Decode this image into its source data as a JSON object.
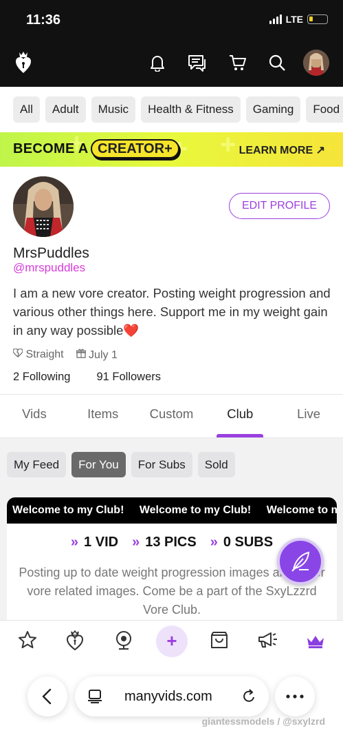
{
  "status": {
    "time": "11:36",
    "network": "LTE"
  },
  "categories": [
    "All",
    "Adult",
    "Music",
    "Health & Fitness",
    "Gaming",
    "Food"
  ],
  "banner": {
    "prefix": "BECOME A",
    "highlight": "CREATOR+",
    "cta": "LEARN MORE ↗"
  },
  "profile": {
    "edit_label": "EDIT PROFILE",
    "name": "MrsPuddles",
    "handle": "@mrspuddles",
    "bio": "I am a new vore creator. Posting weight progression and various other things here. Support me in my weight gain in any way possible❤️",
    "orientation": "Straight",
    "birthday": "July 1",
    "following": "2 Following",
    "followers": "91 Followers"
  },
  "tabs": [
    "Vids",
    "Items",
    "Custom",
    "Club",
    "Live"
  ],
  "active_tab": "Club",
  "subtabs": [
    "My Feed",
    "For You",
    "For Subs",
    "Sold"
  ],
  "active_subtab": "For You",
  "club": {
    "marquee": [
      "Welcome to my Club!",
      "Welcome to my Club!",
      "Welcome to my Club!"
    ],
    "vids": "1 VID",
    "pics": "13 PICS",
    "subs": "0 SUBS",
    "description": "Posting up to date weight progression images and other vore related images. Come be a part of the SxyLzzrd Vore Club."
  },
  "browser": {
    "url": "manyvids.com"
  },
  "watermark": "giantessmodels / @sxylzrd",
  "colors": {
    "accent": "#9a3fe0",
    "handle": "#d63bd9",
    "banner_start": "#bff54a",
    "banner_end": "#f6e43a"
  }
}
